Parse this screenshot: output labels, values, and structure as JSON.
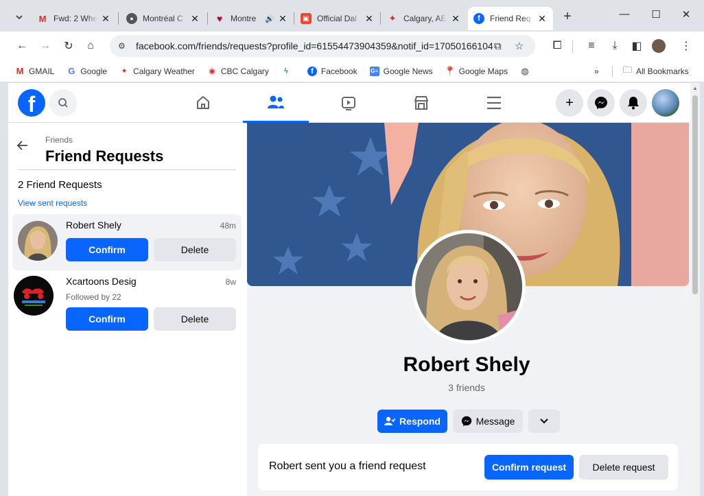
{
  "browser": {
    "tabs": [
      {
        "label": "Fwd: 2 Whe",
        "favicon": "gmail-icon"
      },
      {
        "label": "Montréal C",
        "favicon": "hockey-icon"
      },
      {
        "label": "Montre",
        "favicon": "iheart-icon"
      },
      {
        "label": "Official Dal",
        "favicon": "news-icon"
      },
      {
        "label": "Calgary, AE",
        "favicon": "maple-leaf-icon"
      },
      {
        "label": "Friend Req",
        "favicon": "facebook-icon",
        "active": true
      }
    ],
    "url": "facebook.com/friends/requests?profile_id=61554473904359&notif_id=17050166104...",
    "bookmarks": [
      {
        "label": "GMAIL"
      },
      {
        "label": "Google"
      },
      {
        "label": "Calgary Weather"
      },
      {
        "label": "CBC Calgary"
      },
      {
        "label": ""
      },
      {
        "label": "Facebook"
      },
      {
        "label": "Google News"
      },
      {
        "label": "Google Maps"
      },
      {
        "label": ""
      }
    ],
    "all_bookmarks": "All Bookmarks",
    "overflow": "»"
  },
  "left": {
    "crumb": "Friends",
    "title": "Friend Requests",
    "count": "2 Friend Requests",
    "sent_link": "View sent requests",
    "requests": [
      {
        "name": "Robert Shely",
        "time": "48m",
        "sub": "",
        "confirm": "Confirm",
        "delete": "Delete"
      },
      {
        "name": "Xcartoons Desig",
        "time": "8w",
        "sub": "Followed by 22",
        "confirm": "Confirm",
        "delete": "Delete"
      }
    ]
  },
  "profile": {
    "name": "Robert Shely",
    "friends": "3 friends",
    "respond": "Respond",
    "message": "Message",
    "request_text": "Robert sent you a friend request",
    "confirm_request": "Confirm request",
    "delete_request": "Delete request"
  },
  "colors": {
    "fb_blue": "#0866ff",
    "gray_button": "#e4e6eb",
    "bg": "#f0f2f5"
  }
}
